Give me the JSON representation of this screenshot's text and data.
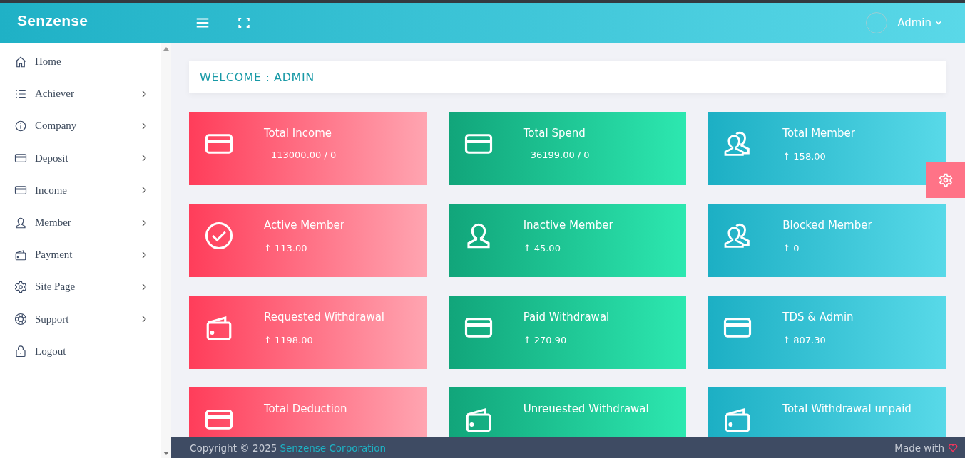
{
  "header": {
    "logo": "Senzense",
    "user": "Admin"
  },
  "sidebar": {
    "items": [
      {
        "label": "Home",
        "kind": "home",
        "has_submenu": false
      },
      {
        "label": "Achiever",
        "kind": "list",
        "has_submenu": true
      },
      {
        "label": "Company",
        "kind": "info",
        "has_submenu": true
      },
      {
        "label": "Deposit",
        "kind": "card",
        "has_submenu": true
      },
      {
        "label": "Income",
        "kind": "card",
        "has_submenu": true
      },
      {
        "label": "Member",
        "kind": "user",
        "has_submenu": true
      },
      {
        "label": "Payment",
        "kind": "wallet",
        "has_submenu": true
      },
      {
        "label": "Site Page",
        "kind": "gear",
        "has_submenu": true
      },
      {
        "label": "Support",
        "kind": "lifebuoy",
        "has_submenu": true
      },
      {
        "label": "Logout",
        "kind": "lock",
        "has_submenu": false
      }
    ]
  },
  "welcome": "WELCOME : ADMIN",
  "cards": [
    {
      "title": "Total Income",
      "value": "113000.00 / 0",
      "kind": "card",
      "color": "#ff3d5a"
    },
    {
      "title": "Total Spend",
      "value": "36199.00 / 0",
      "kind": "card",
      "color": "#11a57a"
    },
    {
      "title": "Total Member",
      "value": "↑ 158.00",
      "kind": "users",
      "color": "#1cafc4"
    },
    {
      "title": "Active Member",
      "value": "↑ 113.00",
      "kind": "check",
      "color": "#ff3d5a"
    },
    {
      "title": "Inactive Member",
      "value": "↑ 45.00",
      "kind": "user",
      "color": "#11a57a"
    },
    {
      "title": "Blocked Member",
      "value": "↑ 0",
      "kind": "users",
      "color": "#1cafc4"
    },
    {
      "title": "Requested Withdrawal",
      "value": "↑ 1198.00",
      "kind": "wallet",
      "color": "#ff3d5a"
    },
    {
      "title": "Paid Withdrawal",
      "value": "↑ 270.90",
      "kind": "card",
      "color": "#11a57a"
    },
    {
      "title": "TDS & Admin",
      "value": "↑ 807.30",
      "kind": "card",
      "color": "#1cafc4"
    },
    {
      "title": "Total Deduction",
      "kind": "card",
      "color": "#ff3d5a"
    },
    {
      "title": "Unreuested Withdrawal",
      "kind": "wallet",
      "color": "#11a57a"
    },
    {
      "title": "Total Withdrawal unpaid",
      "kind": "wallet",
      "color": "#1cafc4"
    }
  ],
  "footer": {
    "copyright": "Copyright © 2025",
    "company": "Senzense Corporation",
    "made_with": "Made with"
  }
}
